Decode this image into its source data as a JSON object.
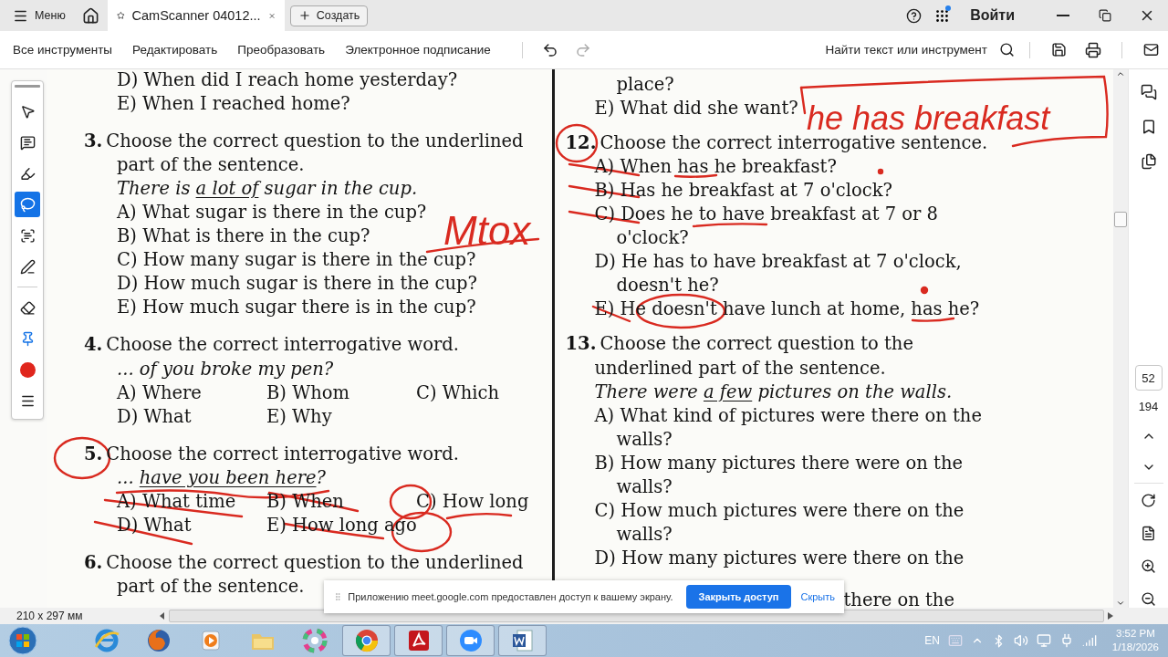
{
  "tab_bar": {
    "menu_label": "Меню",
    "tabs": [
      {
        "title": "CamScanner 04012...",
        "selected": true
      }
    ],
    "create_label": "Создать",
    "sign_in": "Войти"
  },
  "toolbar": {
    "menu": [
      "Все инструменты",
      "Редактировать",
      "Преобразовать",
      "Электронное подписание"
    ],
    "search_label": "Найти текст или инструмент"
  },
  "tool_groups": [
    [
      {
        "kind": "select",
        "selected": false
      },
      {
        "kind": "comment",
        "selected": false
      },
      {
        "kind": "highlight",
        "selected": false
      },
      {
        "kind": "draw",
        "selected": true
      },
      {
        "kind": "textbox",
        "selected": false
      },
      {
        "kind": "sign",
        "selected": false
      }
    ],
    [
      {
        "kind": "eraser",
        "selected": false
      },
      {
        "kind": "pin",
        "selected": false
      },
      {
        "kind": "color",
        "selected": false,
        "color": "#e0261d"
      },
      {
        "kind": "more",
        "selected": false
      }
    ]
  ],
  "document": {
    "columns": [
      {
        "lines": [
          {
            "kind": "option",
            "text": "D) When did I reach home yesterday?"
          },
          {
            "kind": "option",
            "text": "E) When I reached home?"
          },
          {
            "kind": "question",
            "number": "3.",
            "text": "Choose the correct question to the underlined"
          },
          {
            "kind": "text",
            "text": "part of the sentence."
          },
          {
            "kind": "example",
            "parts": [
              {
                "text": "There is ",
                "underlined": false
              },
              {
                "text": "a lot of",
                "underlined": true
              },
              {
                "text": " sugar in the cup.",
                "underlined": false
              }
            ]
          },
          {
            "kind": "option",
            "text": "A) What sugar is there in the cup?"
          },
          {
            "kind": "option",
            "text": "B) What is there in the cup?"
          },
          {
            "kind": "option",
            "text": "C) How many sugar is there in the cup?"
          },
          {
            "kind": "option",
            "text": "D) How much sugar is there in the cup?"
          },
          {
            "kind": "option",
            "text": "E) How much sugar there is in the cup?"
          },
          {
            "kind": "question",
            "number": "4.",
            "text": "Choose the correct interrogative word."
          },
          {
            "kind": "example",
            "parts": [
              {
                "text": "... of you broke my pen?",
                "underlined": false
              }
            ]
          },
          {
            "kind": "options",
            "items": [
              "A) Where",
              "B) Whom",
              "C) Which"
            ]
          },
          {
            "kind": "options",
            "items": [
              "D) What",
              "E) Why"
            ]
          },
          {
            "kind": "question",
            "number": "5.",
            "text": "Choose the correct interrogative word."
          },
          {
            "kind": "example",
            "parts": [
              {
                "text": "... ",
                "underlined": false
              },
              {
                "text": "have you been here",
                "underlined": true
              },
              {
                "text": "?",
                "underlined": false
              }
            ]
          },
          {
            "kind": "options",
            "items": [
              "A) What time",
              "B) When",
              "C) How long"
            ]
          },
          {
            "kind": "options",
            "items": [
              "D) What",
              "E) How long ago"
            ]
          },
          {
            "kind": "question",
            "number": "6.",
            "text": "Choose the correct question to the underlined"
          },
          {
            "kind": "text",
            "text": "part of the sentence."
          }
        ]
      },
      {
        "lines": [
          {
            "kind": "option_cont",
            "text": "place?"
          },
          {
            "kind": "option",
            "text": "E) What did she want?"
          },
          {
            "kind": "question",
            "number": "12.",
            "text": "Choose the correct interrogative sentence."
          },
          {
            "kind": "option",
            "text": "A) When has he breakfast?"
          },
          {
            "kind": "option",
            "text": "B) Has he breakfast at 7 o'clock?"
          },
          {
            "kind": "option",
            "text": "C) Does he to have breakfast at 7 or 8"
          },
          {
            "kind": "option_cont",
            "text": "o'clock?"
          },
          {
            "kind": "option",
            "text": "D) He has to have breakfast at 7 o'clock,"
          },
          {
            "kind": "option_cont",
            "text": "doesn't he?"
          },
          {
            "kind": "option",
            "text": "E) He doesn't have lunch at home, has he?"
          },
          {
            "kind": "question",
            "number": "13.",
            "text": "Choose the correct question to the"
          },
          {
            "kind": "text",
            "text": "underlined part of the sentence."
          },
          {
            "kind": "example",
            "parts": [
              {
                "text": "There were ",
                "underlined": false
              },
              {
                "text": "a few",
                "underlined": true
              },
              {
                "text": " pictures on the walls.",
                "underlined": false
              }
            ]
          },
          {
            "kind": "option",
            "text": "A) What kind of pictures were there on the"
          },
          {
            "kind": "option_cont",
            "text": "walls?"
          },
          {
            "kind": "option",
            "text": "B) How many pictures there were on the"
          },
          {
            "kind": "option_cont",
            "text": "walls?"
          },
          {
            "kind": "option",
            "text": "C) How much pictures were there on the"
          },
          {
            "kind": "option_cont",
            "text": "walls?"
          },
          {
            "kind": "option",
            "text": "D) How many pictures were there on the"
          },
          {
            "kind": "tail",
            "text": "there on the"
          }
        ]
      }
    ]
  },
  "ink_notes": [
    "he has breakfast",
    "Mtox"
  ],
  "page_nav": {
    "current": "52",
    "total": "194"
  },
  "status_bar": {
    "page_size": "210 x 297 мм"
  },
  "share_banner": {
    "message": "Приложению meet.google.com предоставлен доступ к вашему экрану.",
    "stop_button": "Закрыть доступ",
    "hide_link": "Скрыть"
  },
  "taskbar": {
    "apps": [
      {
        "kind": "ie",
        "running": false
      },
      {
        "kind": "firefox",
        "running": false
      },
      {
        "kind": "media",
        "running": false
      },
      {
        "kind": "explorer",
        "running": false
      },
      {
        "kind": "photos",
        "running": false
      },
      {
        "kind": "chrome",
        "running": true
      },
      {
        "kind": "acrobat",
        "running": true
      },
      {
        "kind": "zoom",
        "running": true
      },
      {
        "kind": "word",
        "running": true
      }
    ],
    "language": "EN",
    "time": "3:52 PM",
    "date": "1/18/2026"
  }
}
